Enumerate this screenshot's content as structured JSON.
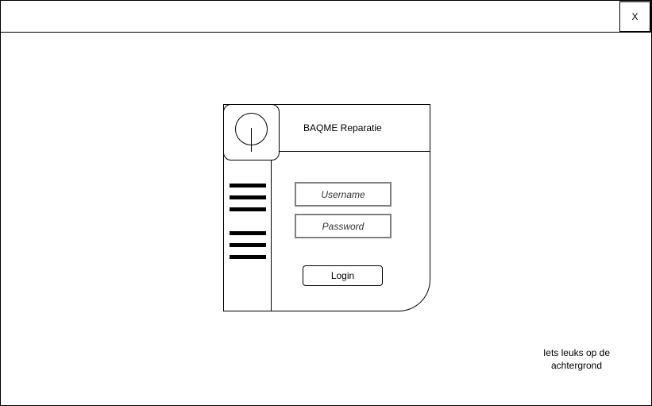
{
  "window": {
    "close_label": "X"
  },
  "login_panel": {
    "title": "BAQME Reparatie",
    "username_placeholder": "Username",
    "password_placeholder": "Password",
    "login_label": "Login",
    "logo_icon": "circle-logo-icon",
    "menu_icon": "hamburger-menu-icon"
  },
  "background": {
    "note_line1": "Iets leuks op de",
    "note_line2": "achtergrond"
  }
}
